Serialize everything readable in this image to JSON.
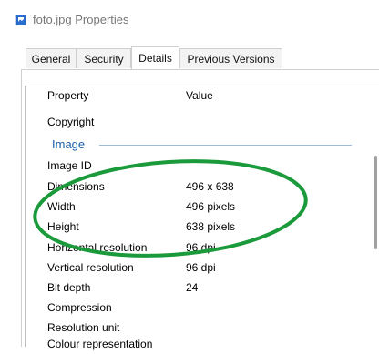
{
  "window": {
    "title": "foto.jpg Properties",
    "icon": "image-file-icon"
  },
  "tabs": [
    {
      "label": "General",
      "active": false
    },
    {
      "label": "Security",
      "active": false
    },
    {
      "label": "Details",
      "active": true
    },
    {
      "label": "Previous Versions",
      "active": false
    }
  ],
  "details": {
    "columns": {
      "property": "Property",
      "value": "Value"
    },
    "rows_top": [
      {
        "property": "Copyright",
        "value": ""
      }
    ],
    "group_label": "Image",
    "rows": [
      {
        "property": "Image ID",
        "value": ""
      },
      {
        "property": "Dimensions",
        "value": "496 x 638"
      },
      {
        "property": "Width",
        "value": "496 pixels"
      },
      {
        "property": "Height",
        "value": "638 pixels"
      },
      {
        "property": "Horizontal resolution",
        "value": "96 dpi"
      },
      {
        "property": "Vertical resolution",
        "value": "96 dpi"
      },
      {
        "property": "Bit depth",
        "value": "24"
      },
      {
        "property": "Compression",
        "value": ""
      },
      {
        "property": "Resolution unit",
        "value": ""
      },
      {
        "property": "Colour representation",
        "value": ""
      }
    ]
  },
  "annotation": {
    "color": "#1a9a3a"
  },
  "colors": {
    "group_label": "#1a5fa8",
    "tab_active_bg": "#ffffff"
  }
}
